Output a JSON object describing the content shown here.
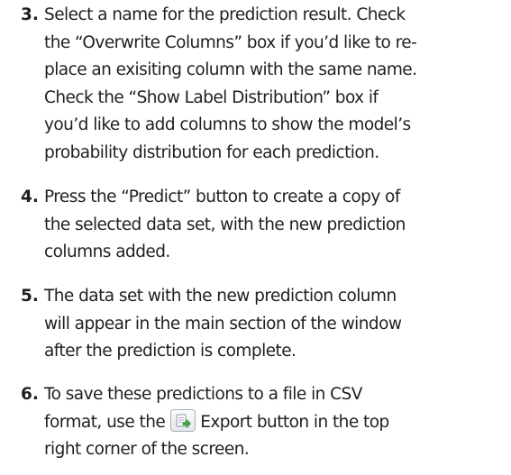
{
  "steps": [
    {
      "number": "3.",
      "lines": [
        "Select a name for the prediction result. Check",
        "the “Overwrite Columns” box if you’d like to re-",
        "place an exisiting column with the same name.",
        "Check the “Show Label Distribution” box if",
        "you’d like to add columns to show the model’s",
        "probability distribution for each prediction."
      ]
    },
    {
      "number": "4.",
      "lines": [
        "Press the “Predict” button to create a copy of",
        "the selected data set, with the new prediction",
        "columns added."
      ]
    },
    {
      "number": "5.",
      "lines": [
        "The data set with the new prediction column",
        "will appear in the main section of the window",
        "after the prediction is complete."
      ]
    },
    {
      "number": "6.",
      "line1": "To save these predictions to a file in CSV",
      "line2_before": "format, use the",
      "line2_after": "Export button in the top",
      "line3": "right corner of the screen.",
      "icon": "export-icon"
    }
  ]
}
